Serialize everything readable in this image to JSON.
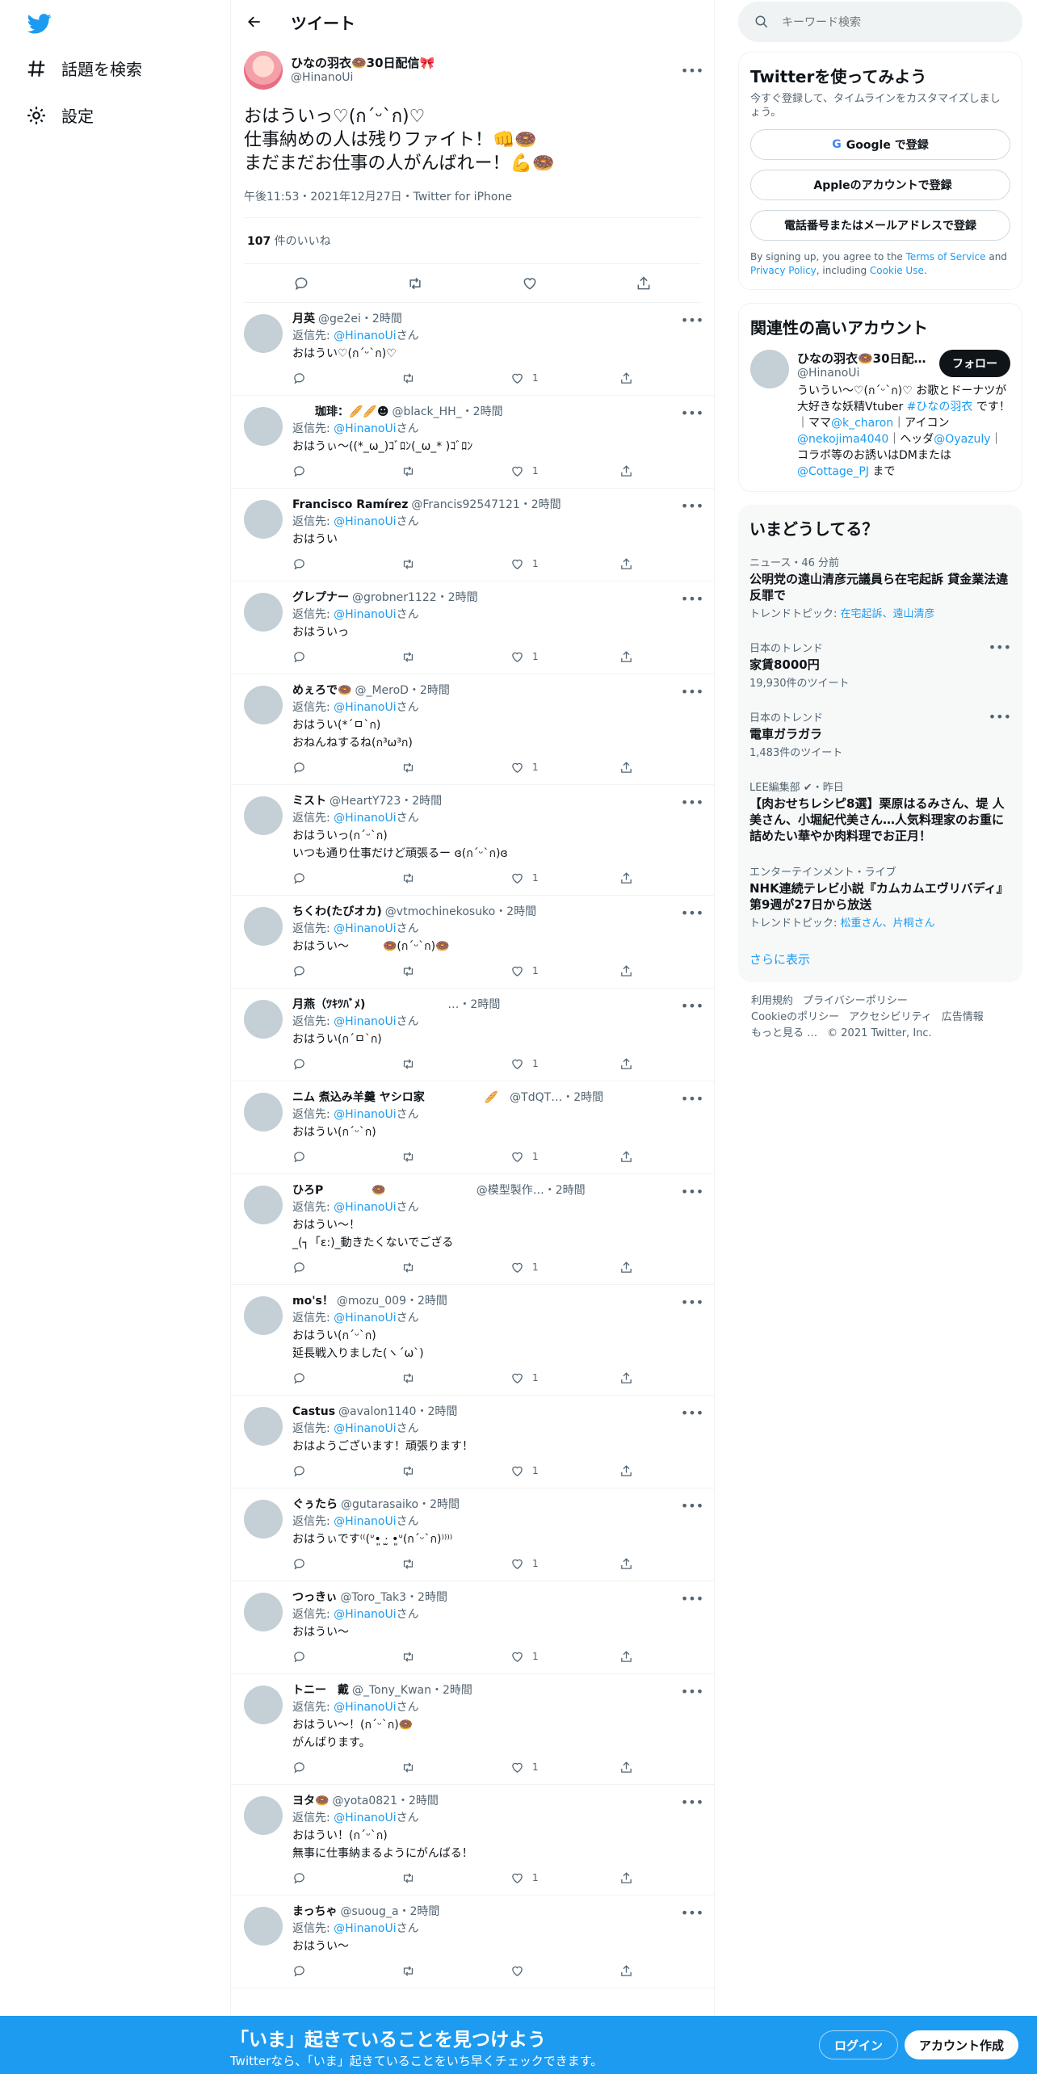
{
  "nav": {
    "explore": "話題を検索",
    "settings": "設定"
  },
  "header": {
    "title": "ツイート"
  },
  "tweet": {
    "name": "ひなの羽衣🍩30日配信🎀",
    "handle": "@HinanoUi",
    "text": "おはういっ♡(ก´ᵕ`ก)♡\n仕事納めの人は残りファイト！👊🍩\nまだまだお仕事の人がんばれー！💪🍩",
    "meta": "午後11:53・2021年12月27日・Twitter for iPhone",
    "likes_count": "107",
    "likes_label": " 件のいいね"
  },
  "reply_prefix": "返信先: ",
  "reply_to": "@HinanoUi",
  "reply_suffix": "さん",
  "replies": [
    {
      "name": "月英",
      "handle": "@ge2ei・2時間",
      "text": "おはうい♡(ก´ᵕ`ก)♡",
      "likes": "1"
    },
    {
      "name": "　　珈琲：🥖🥖☻",
      "handle": "@black_HH_・2時間",
      "text": "おはうぃ〜((*_ω_)ｺﾞﾛﾝ(_ω_* )ｺﾞﾛﾝ",
      "likes": "1"
    },
    {
      "name": "Francisco Ramírez",
      "handle": "@Francis92547121・2時間",
      "text": "おはうい",
      "likes": "1"
    },
    {
      "name": "グレプナー",
      "handle": "@grobner1122・2時間",
      "text": "おはういっ",
      "likes": "1"
    },
    {
      "name": "めぇろで🍩",
      "handle": "@_MeroD・2時間",
      "text": "おはうい(*´ㅁ`ก)\nおねんねするね(ก³ω³ก)",
      "likes": "1"
    },
    {
      "name": "ミスト",
      "handle": "@HeartY723・2時間",
      "text": "おはういっ(ก´ᵕ`ก)\nいつも通り仕事だけど頑張るー ɞ(ก´ᵕ`ก)ɞ",
      "likes": "1"
    },
    {
      "name": "ちくわ(たびオカ)",
      "handle": "@vtmochinekosuko・2時間",
      "text": "おはうい〜　　　🍩(ก´ᵕ`ก)🍩",
      "likes": "1"
    },
    {
      "name": "月燕（ﾂｷﾂﾊﾞﾒ)",
      "handle": "　　　　　　　…・2時間",
      "text": "おはうい(ก´ㅁ`ก)",
      "likes": "1"
    },
    {
      "name": "ニム 煮込み羊羹 ヤシロ家",
      "handle": "　　　　　🥖　@TdQT…・2時間",
      "text": "おはうい(ก´ᵕ`ก)",
      "likes": "1"
    },
    {
      "name": "ひろP",
      "handle": "　　　　🍩　　　　　　　　@模型製作…・2時間",
      "text": "おはうい〜！\n_(┐「ε:)_動きたくないでござる",
      "likes": "1"
    },
    {
      "name": "mo's！",
      "handle": "@mozu_009・2時間",
      "text": "おはうい(ก´ᵕ`ก)\n延長戦入りました(ヽ´ω`)",
      "likes": "1"
    },
    {
      "name": "Castus",
      "handle": "@avalon1140・2時間",
      "text": "おはようございます！頑張ります！",
      "likes": "1"
    },
    {
      "name": "ぐぅたら",
      "handle": "@gutarasaiko・2時間",
      "text": "おはうぃです⁽⁽(ᐡ•͈ ·̫ •͈ᐡ(ก´ᵕ`ก)⁾⁾⁾⁾",
      "likes": "1"
    },
    {
      "name": "つっきぃ",
      "handle": "@Toro_Tak3・2時間",
      "text": "おはうい〜",
      "likes": "1"
    },
    {
      "name": "トニー　戴",
      "handle": "@_Tony_Kwan・2時間",
      "text": "おはうい〜！(ก´ᵕ`ก)🍩\nがんばります。",
      "likes": "1"
    },
    {
      "name": "ヨタ🍩",
      "handle": "@yota0821・2時間",
      "text": "おはうい！(ก´ᵕ`ก)\n無事に仕事納まるようにがんばる！",
      "likes": "1"
    },
    {
      "name": "まっちゃ",
      "handle": "@suoug_a・2時間",
      "text": "おはうい〜",
      "likes": ""
    }
  ],
  "search": {
    "placeholder": "キーワード検索"
  },
  "signup_card": {
    "title": "Twitterを使ってみよう",
    "subtitle": "今すぐ登録して、タイムラインをカスタマイズしましょう。",
    "google": "Google で登録",
    "apple": "Appleのアカウントで登録",
    "phone": "電話番号またはメールアドレスで登録",
    "legal_1": "By signing up, you agree to the ",
    "terms": "Terms of Service",
    "legal_2": " and ",
    "privacy": "Privacy Policy",
    "legal_3": ", including ",
    "cookie": "Cookie Use",
    "legal_4": "."
  },
  "related": {
    "title": "関連性の高いアカウント",
    "name": "ひなの羽衣🍩30日配…",
    "handle": "@HinanoUi",
    "follow": "フォロー",
    "bio_1": "ういうい〜♡(ก´ᵕ`ก)♡ お歌とドーナツが大好きな妖精Vtuber ",
    "tag": "#ひなの羽衣",
    "bio_2": " です！　｜ママ",
    "mama": "@k_charon",
    "bio_3": "｜アイコン",
    "icon": "@nekojima4040",
    "bio_4": "｜ヘッダ",
    "header": "@Oyazuly",
    "bio_5": "｜コラボ等のお誘いはDMまたは",
    "dm": "@Cottage_PJ",
    "bio_6": " まで"
  },
  "trends": {
    "title": "いまどうしてる？",
    "items": [
      {
        "meta": "ニュース・46 分前",
        "title": "公明党の遠山清彦元議員ら在宅起訴 貸金業法違反罪で",
        "sub_label": "トレンドトピック: ",
        "sub_links": "在宅起訴、遠山清彦"
      },
      {
        "meta": "日本のトレンド",
        "title": "家賃8000円",
        "sub": "19,930件のツイート"
      },
      {
        "meta": "日本のトレンド",
        "title": "電車ガラガラ",
        "sub": "1,483件のツイート"
      },
      {
        "meta": "LEE編集部 ✔・昨日",
        "title": "【肉おせちレシピ8選】栗原はるみさん、堤 人美さん、小堀紀代美さん…人気料理家のお重に詰めたい華やか肉料理でお正月！"
      },
      {
        "meta": "エンターテインメント・ライブ",
        "title": "NHK連続テレビ小説『カムカムエヴリバディ』第9週が27日から放送",
        "sub_label": "トレンドトピック: ",
        "sub_links": "松重さん、片桐さん"
      }
    ],
    "show_more": "さらに表示"
  },
  "footer": {
    "terms": "利用規約",
    "privacy": "プライバシーポリシー",
    "cookie": "Cookieのポリシー",
    "a11y": "アクセシビリティ",
    "ads": "広告情報",
    "more": "もっと見る …",
    "copyright": "© 2021 Twitter, Inc."
  },
  "bottom": {
    "title": "「いま」起きていることを見つけよう",
    "subtitle": "Twitterなら、「いま」起きていることをいち早くチェックできます。",
    "login": "ログイン",
    "signup": "アカウント作成"
  },
  "colors": {
    "accent": "#1d9bf0",
    "text": "#0f1419",
    "muted": "#536471"
  }
}
